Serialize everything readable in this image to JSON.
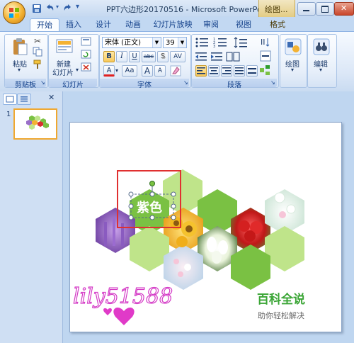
{
  "window": {
    "title": "PPT六边形20170516 - Microsoft PowerPo...",
    "context_tab": "绘图..."
  },
  "tabs": [
    "开始",
    "插入",
    "设计",
    "动画",
    "幻灯片放映",
    "审阅",
    "视图",
    "格式"
  ],
  "clipboard": {
    "paste": "粘贴",
    "group": "剪贴板"
  },
  "slides": {
    "new_slide_1": "新建",
    "new_slide_2": "幻灯片",
    "group": "幻灯片"
  },
  "font": {
    "name": "宋体 (正文)",
    "size": "39",
    "group": "字体",
    "bold": "B",
    "italic": "I",
    "underline": "U",
    "strike": "abc",
    "shadow": "S",
    "spacing": "AV",
    "color": "A",
    "case": "Aa",
    "grow": "A",
    "shrink": "A"
  },
  "paragraph": {
    "group": "段落"
  },
  "drawing": {
    "label": "绘图"
  },
  "editing": {
    "label": "编辑"
  },
  "thumbnail": {
    "number": "1"
  },
  "slide": {
    "hex_text": "紫色",
    "watermark": "lily51588",
    "brand_title": "百科全说",
    "brand_subtitle": "助你轻松解决"
  },
  "colors": {
    "green": "#7ac143",
    "light_green": "#bfe48a",
    "brand_green": "#3aa535",
    "watermark": "#d43ac6",
    "highlight": "#e03030",
    "accent_orange": "#f3b233"
  }
}
